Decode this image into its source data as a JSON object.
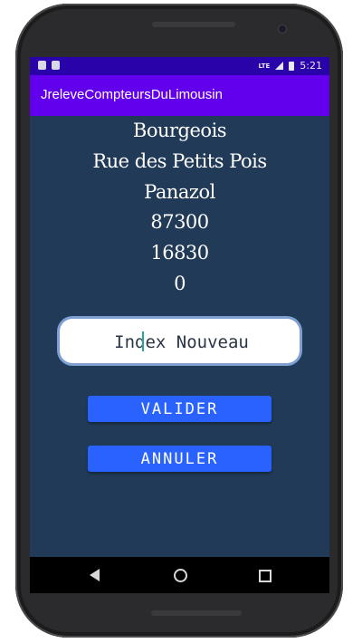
{
  "statusbar": {
    "network": "LTE",
    "time": "5:21",
    "color": "#2a02a9"
  },
  "appbar": {
    "title": "JreleveCompteursDuLimousin",
    "color": "#6200ee"
  },
  "details": {
    "name": "Bourgeois",
    "street": "Rue des Petits Pois",
    "city": "Panazol",
    "postal_code": "87300",
    "old_index": "16830",
    "value": "0"
  },
  "input": {
    "placeholder": "Index Nouveau",
    "value": ""
  },
  "buttons": {
    "validate_label": "VALIDER",
    "cancel_label": "ANNULER",
    "color": "#2962ff"
  },
  "navbar": {
    "back_icon": "back-icon",
    "home_icon": "home-icon",
    "recents_icon": "recents-icon"
  },
  "theme": {
    "content_background": "#203a57"
  }
}
